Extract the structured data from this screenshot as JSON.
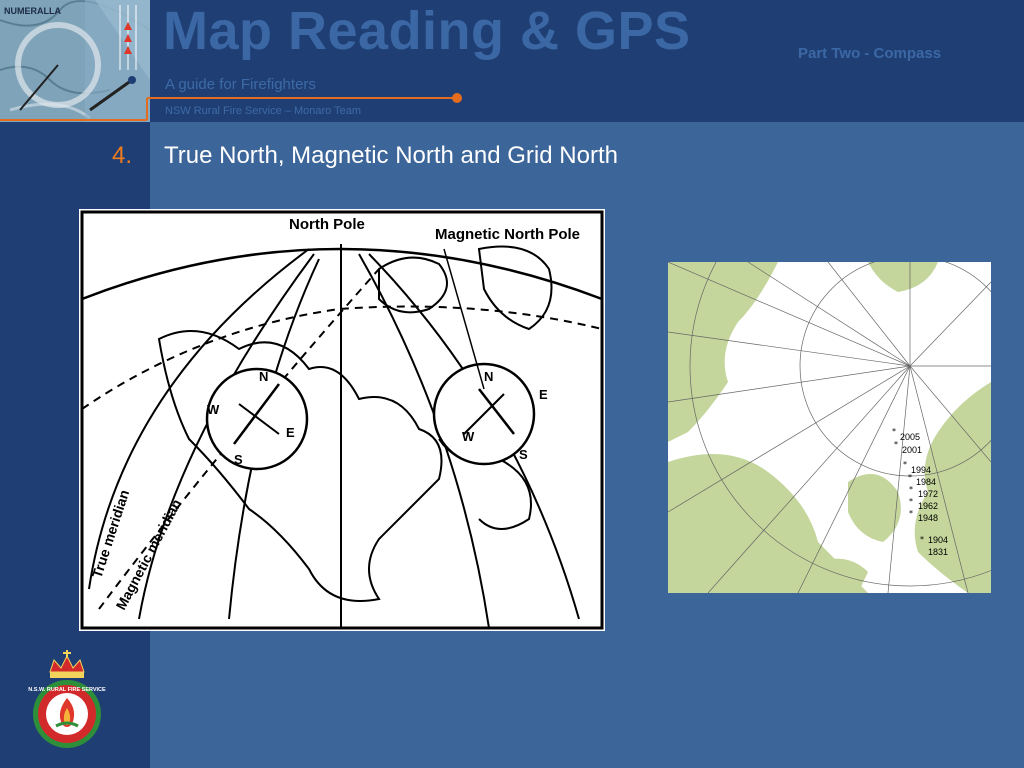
{
  "header": {
    "title": "Map Reading & GPS",
    "subtitle": "Part Two - Compass",
    "tagline": "A guide for Firefighters",
    "team": "NSW Rural Fire Service – Monaro Team",
    "thumbnail_label": "NUMERALLA"
  },
  "content": {
    "heading_number": "4.",
    "heading_text": "True North, Magnetic North and Grid North"
  },
  "figure_left": {
    "labels": {
      "north_pole": "North Pole",
      "magnetic_north_pole": "Magnetic North Pole",
      "true_meridian": "True meridian",
      "magnetic_meridian": "Magnetic meridian",
      "compass_points": [
        "N",
        "E",
        "S",
        "W"
      ]
    }
  },
  "figure_right": {
    "year_labels": [
      "2005",
      "2001",
      "1994",
      "1984",
      "1972",
      "1962",
      "1948",
      "1904",
      "1831"
    ]
  },
  "logo": {
    "text": "N.S.W. RURAL FIRE SERVICE"
  },
  "colors": {
    "background": "#3c6599",
    "header": "#1f3f74",
    "title": "#3b68a5",
    "accent_orange": "#e36c1e",
    "land": "#c4d69b"
  }
}
